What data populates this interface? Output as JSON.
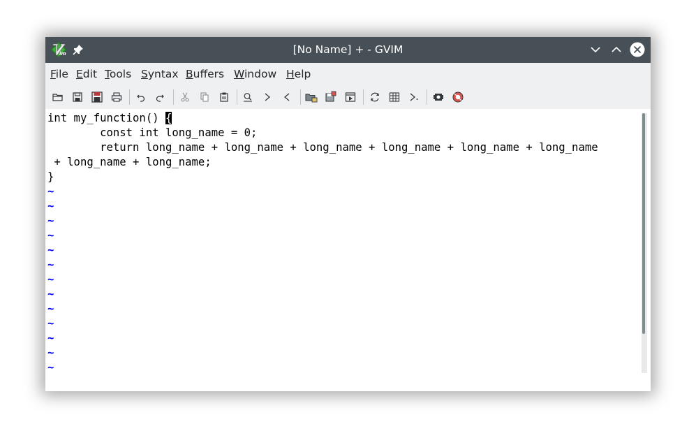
{
  "window": {
    "title": "[No Name] + - GVIM"
  },
  "menubar": {
    "items": [
      {
        "mnemonic": "F",
        "rest": "ile"
      },
      {
        "mnemonic": "E",
        "rest": "dit"
      },
      {
        "mnemonic": "T",
        "rest": "ools"
      },
      {
        "mnemonic": "S",
        "rest": "yntax"
      },
      {
        "mnemonic": "B",
        "rest": "uffers"
      },
      {
        "mnemonic": "W",
        "rest": "indow"
      },
      {
        "mnemonic": "H",
        "rest": "elp"
      }
    ]
  },
  "toolbar": {
    "icons": [
      "open-folder-icon",
      "save-icon",
      "save-all-icon",
      "print-icon",
      "undo-icon",
      "redo-icon",
      "cut-icon",
      "copy-icon",
      "paste-icon",
      "find-replace-icon",
      "find-next-icon",
      "find-previous-icon",
      "load-session-icon",
      "save-session-icon",
      "run-script-icon",
      "make-icon",
      "run-ctags-icon",
      "jump-to-tag-icon",
      "help-icon",
      "find-help-icon"
    ]
  },
  "editor": {
    "lines": [
      {
        "before": "int my_function() ",
        "cursor": "{",
        "after": ""
      },
      {
        "before": "        const int long_name = 0;",
        "cursor": "",
        "after": ""
      },
      {
        "before": "        return long_name + long_name + long_name + long_name + long_name + long_name",
        "cursor": "",
        "after": ""
      },
      {
        "before": " + long_name + long_name;",
        "cursor": "",
        "after": ""
      },
      {
        "before": "}",
        "cursor": "",
        "after": ""
      }
    ],
    "tilde_char": "~",
    "tilde_count": 13
  },
  "colors": {
    "titlebar": "#475057",
    "chrome": "#eff0f1",
    "tilde": "#0000ff",
    "text": "#000000"
  }
}
